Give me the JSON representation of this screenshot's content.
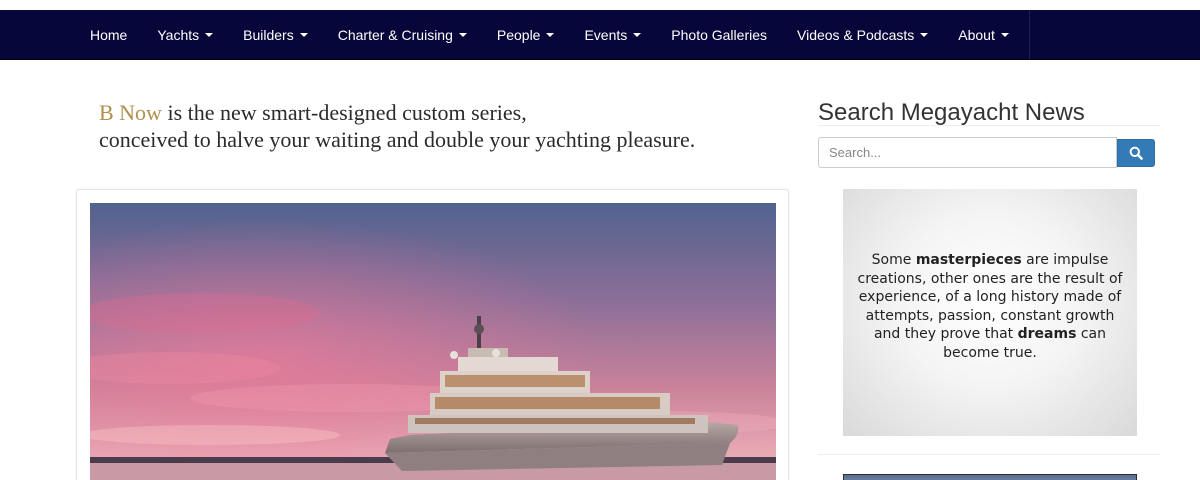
{
  "nav": {
    "items": [
      {
        "label": "Home",
        "dropdown": false
      },
      {
        "label": "Yachts",
        "dropdown": true
      },
      {
        "label": "Builders",
        "dropdown": true
      },
      {
        "label": "Charter & Cruising",
        "dropdown": true
      },
      {
        "label": "People",
        "dropdown": true
      },
      {
        "label": "Events",
        "dropdown": true
      },
      {
        "label": "Photo Galleries",
        "dropdown": false
      },
      {
        "label": "Videos & Podcasts",
        "dropdown": true
      },
      {
        "label": "About",
        "dropdown": true
      }
    ],
    "background": "#06063a"
  },
  "ad_banner": {
    "brand": "B Now",
    "line1_rest": " is the new smart-designed custom series,",
    "line2": "conceived to halve your waiting and double your yachting pleasure.",
    "brand_color": "#b08f4e"
  },
  "sidebar": {
    "title": "Search Megayacht News",
    "search_placeholder": "Search...",
    "search_icon": "search-icon",
    "button_color": "#337ab7",
    "ad": {
      "t1": "Some ",
      "b1": "masterpieces",
      "t2": " are impulse creations, other ones are the result of experience, of a long history made of attempts, passion, constant growth and they prove that ",
      "b2": "dreams",
      "t3": " can become true."
    }
  }
}
